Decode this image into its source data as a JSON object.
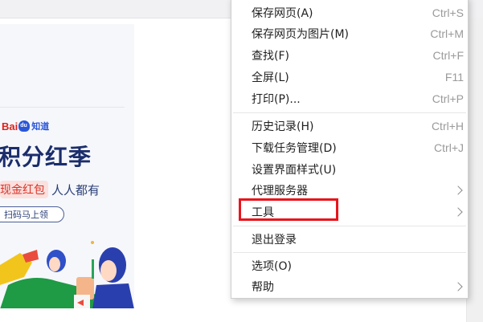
{
  "menu": {
    "items": [
      {
        "label": "保存网页(A)",
        "shortcut": "Ctrl+S"
      },
      {
        "label": "保存网页为图片(M)",
        "shortcut": "Ctrl+M"
      },
      {
        "label": "查找(F)",
        "shortcut": "Ctrl+F"
      },
      {
        "label": "全屏(L)",
        "shortcut": "F11"
      },
      {
        "label": "打印(P)...",
        "shortcut": "Ctrl+P"
      },
      {
        "label": "历史记录(H)",
        "shortcut": "Ctrl+H"
      },
      {
        "label": "下载任务管理(D)",
        "shortcut": "Ctrl+J"
      },
      {
        "label": "设置界面样式(U)",
        "shortcut": ""
      },
      {
        "label": "代理服务器",
        "shortcut": ""
      },
      {
        "label": "工具",
        "shortcut": ""
      },
      {
        "label": "退出登录",
        "shortcut": ""
      },
      {
        "label": "选项(O)",
        "shortcut": ""
      },
      {
        "label": "帮助",
        "shortcut": ""
      }
    ],
    "highlight_color": "#e8141c"
  },
  "ad": {
    "logo_bai": "Bai",
    "logo_du": "du",
    "logo_zhidao": "知道",
    "title": "积分红季",
    "chip": "现金红包",
    "sub": "人人都有",
    "button": "扫码马上领"
  }
}
